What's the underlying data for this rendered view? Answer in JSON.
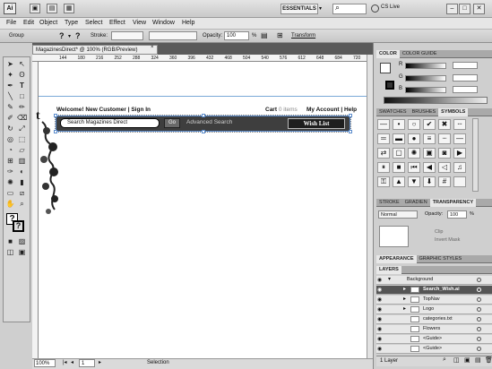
{
  "titlebar": {
    "logo": "Ai",
    "workspace": "ESSENTIALS",
    "cslive": "CS Live"
  },
  "menu": [
    "File",
    "Edit",
    "Object",
    "Type",
    "Select",
    "Effect",
    "View",
    "Window",
    "Help"
  ],
  "control": {
    "group_label": "Group",
    "stroke_label": "Stroke:",
    "opacity_label": "Opacity:",
    "opacity_value": "100",
    "percent": "%",
    "transform_label": "Transform"
  },
  "document": {
    "tab_title": "MagazinesDirect* @ 100% (RGB/Preview)",
    "ruler_ticks": [
      "144",
      "180",
      "216",
      "252",
      "288",
      "324",
      "360",
      "396",
      "432",
      "468",
      "504",
      "540",
      "576",
      "612",
      "648",
      "684",
      "720",
      "756"
    ],
    "site": {
      "welcome": "Welcome!  New Customer | Sign In",
      "cart": "Cart",
      "cart_items": "0 items",
      "account": "My Account | Help",
      "search_placeholder": "Search Magazines Direct",
      "go": "Go",
      "advanced": "Advanced Search",
      "wish": "Wish List",
      "letter": "t"
    }
  },
  "status": {
    "zoom": "100%",
    "page": "1",
    "tool": "Selection"
  },
  "panels": {
    "color_tabs": [
      "COLOR",
      "COLOR GUIDE"
    ],
    "color_labels": [
      "R",
      "G",
      "B"
    ],
    "symbol_tabs": [
      "SWATCHES",
      "BRUSHES",
      "SYMBOLS"
    ],
    "transparency_tabs": [
      "STROKE",
      "GRADIEN",
      "TRANSPARENCY"
    ],
    "blend_mode": "Normal",
    "opacity_label": "Opacity:",
    "opacity_value": "100",
    "percent": "%",
    "clip": "Clip",
    "invert": "Invert Mask",
    "appearance_tabs": [
      "APPEARANCE",
      "GRAPHIC STYLES"
    ],
    "layers_tab": "LAYERS",
    "layers": [
      {
        "name": "Background",
        "level": 0,
        "selected": false
      },
      {
        "name": "Search_Wish.ai",
        "level": 1,
        "selected": true
      },
      {
        "name": "TopNav",
        "level": 1,
        "selected": false
      },
      {
        "name": "Logo",
        "level": 1,
        "selected": false
      },
      {
        "name": "categories.txt",
        "level": 1,
        "selected": false
      },
      {
        "name": "Flowers",
        "level": 1,
        "selected": false
      },
      {
        "name": "<Guide>",
        "level": 1,
        "selected": false
      },
      {
        "name": "<Guide>",
        "level": 1,
        "selected": false
      }
    ],
    "layers_count": "1 Layer"
  }
}
